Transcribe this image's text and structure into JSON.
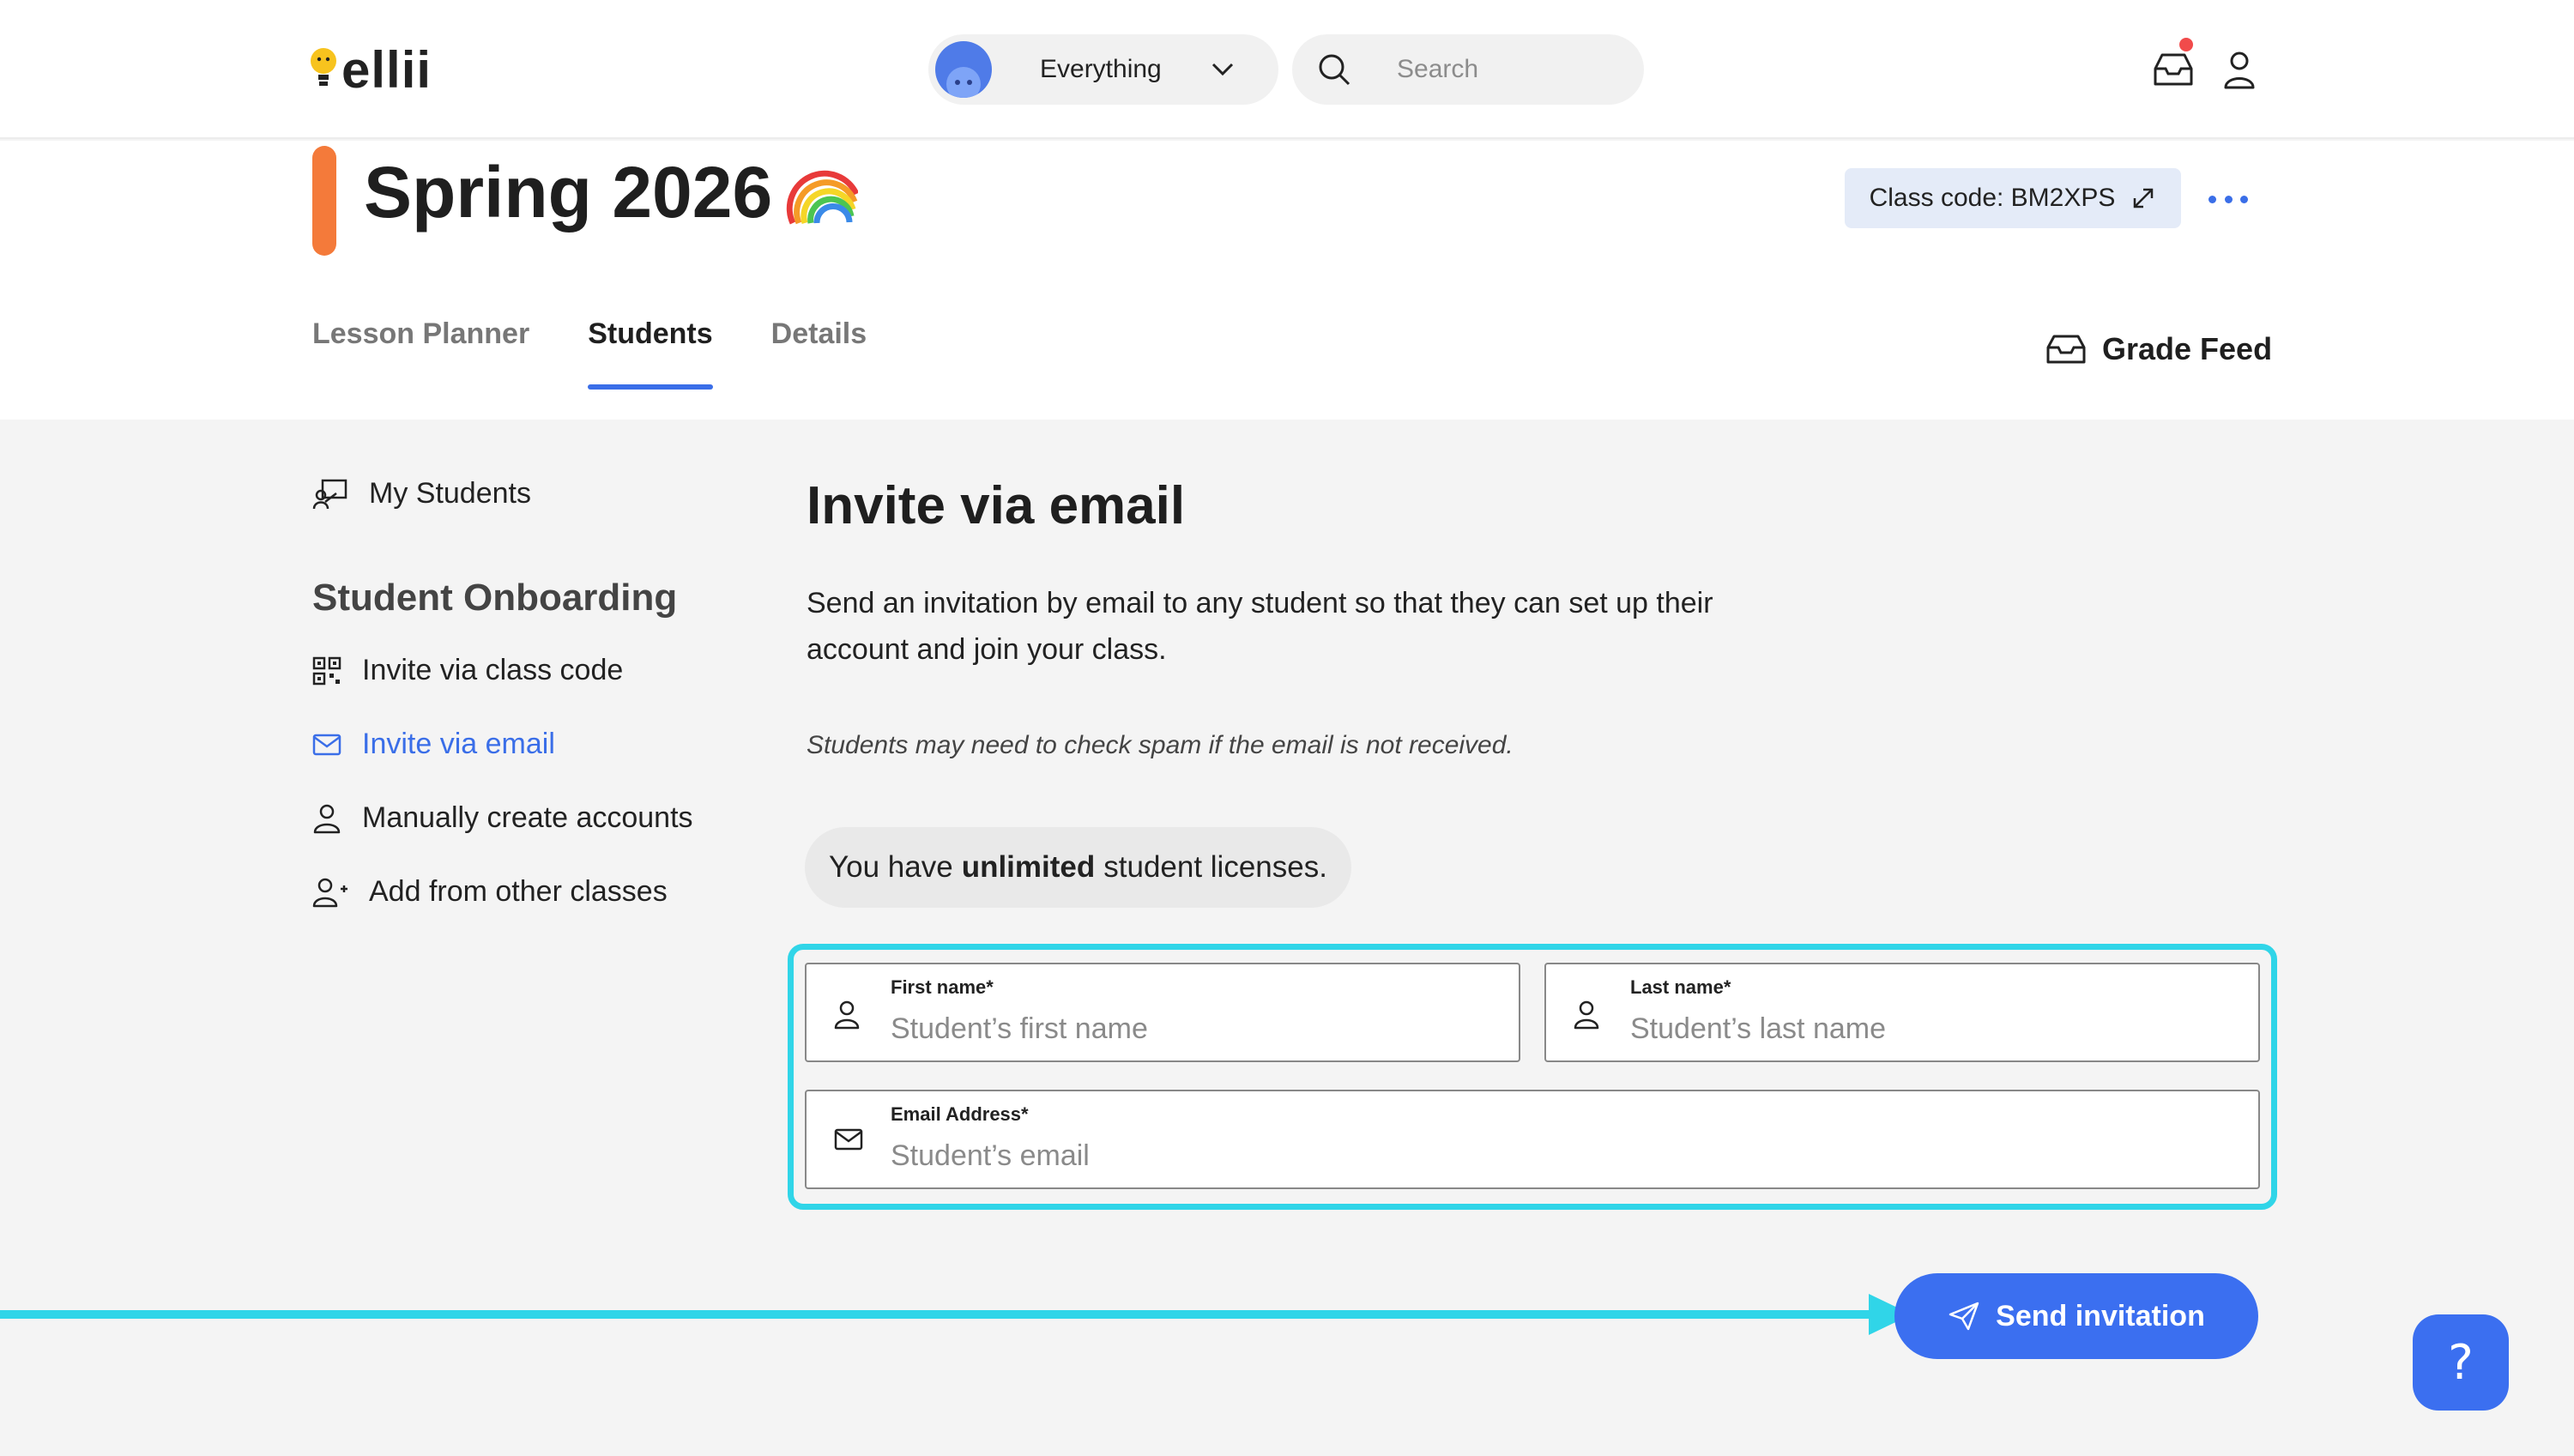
{
  "app": {
    "logo_text": "ellii"
  },
  "topnav": {
    "scope_label": "Everything",
    "search_placeholder": "Search"
  },
  "class": {
    "title": "Spring 2026",
    "code_label": "Class code: BM2XPS",
    "accent_color": "#f47a3a"
  },
  "tabs": [
    {
      "label": "Lesson Planner",
      "active": false
    },
    {
      "label": "Students",
      "active": true
    },
    {
      "label": "Details",
      "active": false
    }
  ],
  "grade_feed_label": "Grade Feed",
  "sidebar": {
    "my_students": "My Students",
    "heading": "Student Onboarding",
    "items": [
      {
        "label": "Invite via class code",
        "icon": "qr-code-icon"
      },
      {
        "label": "Invite via email",
        "icon": "envelope-icon",
        "active": true
      },
      {
        "label": "Manually create accounts",
        "icon": "user-icon"
      },
      {
        "label": "Add from other classes",
        "icon": "user-plus-icon"
      }
    ]
  },
  "main": {
    "title": "Invite via email",
    "description": "Send an invitation by email to any student so that they can set up their account and join your class.",
    "note": "Students may need to check spam if the email is not received.",
    "license_prefix": "You have",
    "license_bold": "unlimited",
    "license_suffix": "student licenses."
  },
  "form": {
    "first_name_label": "First name*",
    "first_name_placeholder": "Student’s first name",
    "last_name_label": "Last name*",
    "last_name_placeholder": "Student’s last name",
    "email_label": "Email Address*",
    "email_placeholder": "Student’s email"
  },
  "send_button_label": "Send invitation",
  "help_button_label": "?",
  "colors": {
    "primary": "#3b6ff0",
    "highlight": "#30d5e8",
    "notification": "#f14b4b"
  }
}
